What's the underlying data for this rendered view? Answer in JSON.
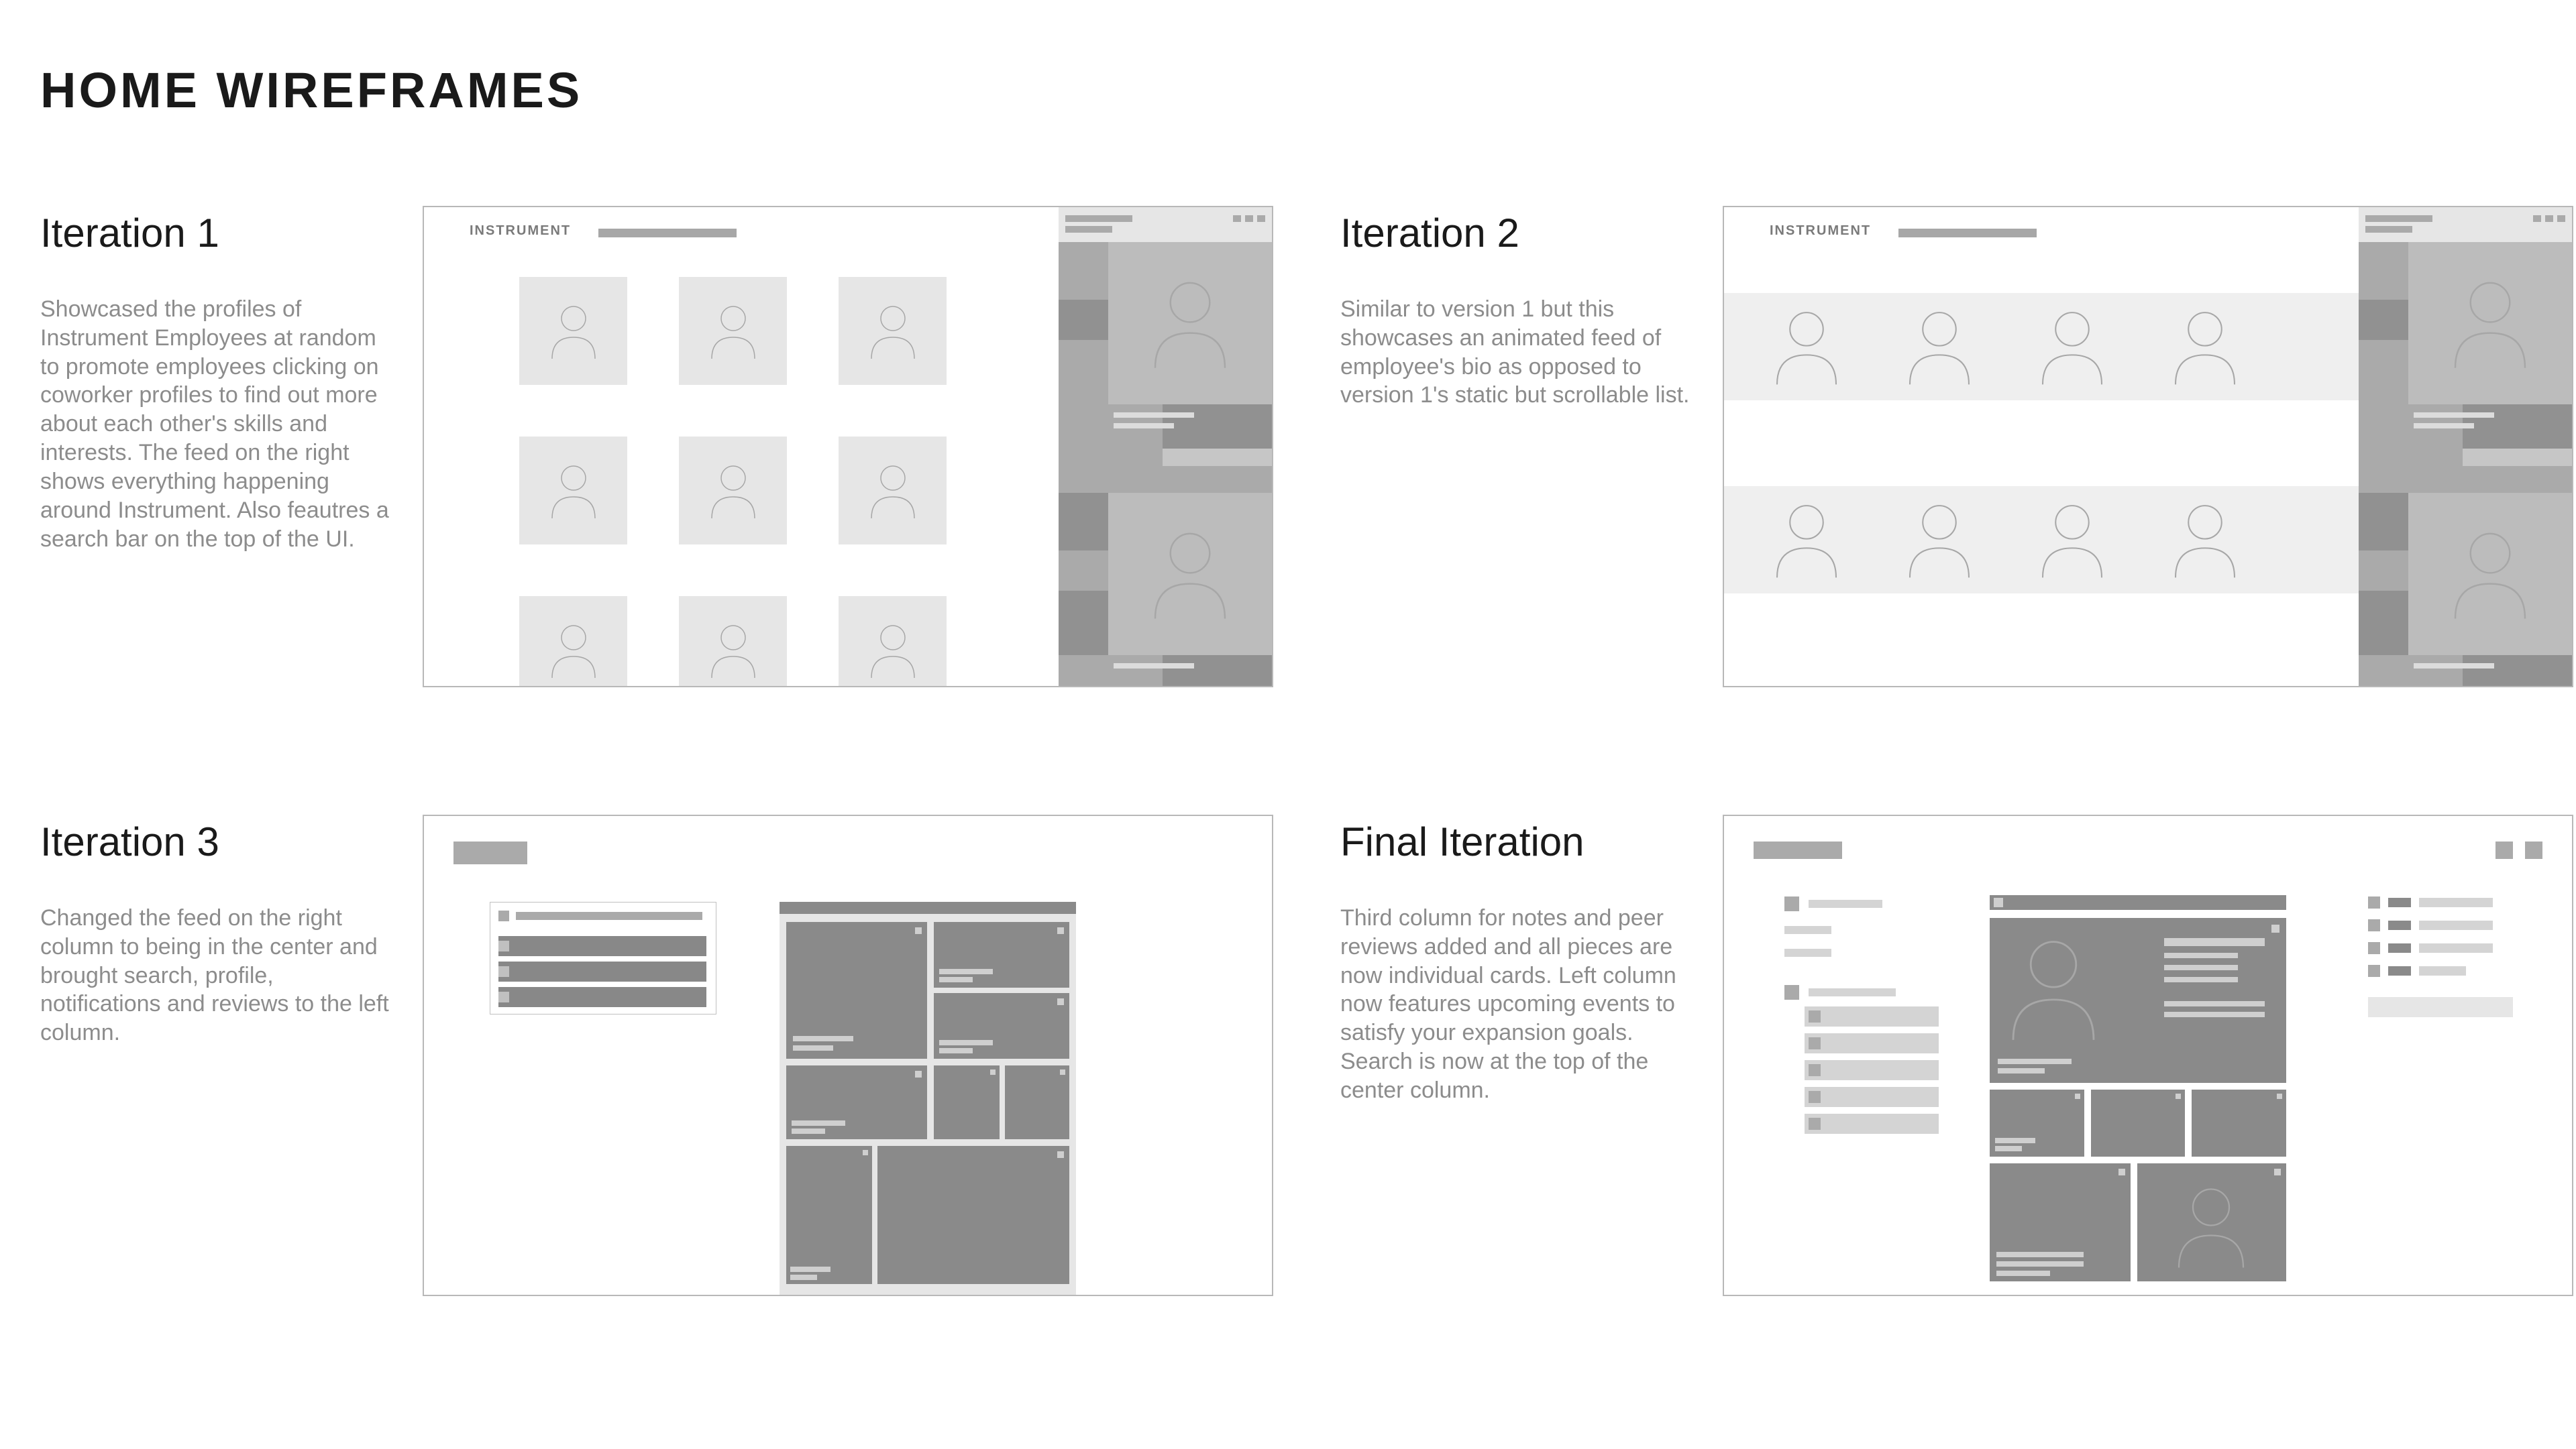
{
  "page_title": "HOME WIREFRAMES",
  "iterations": [
    {
      "title": "Iteration 1",
      "body": "Showcased the profiles of Instrument Employees at random to promote employees clicking on coworker profiles to find out more about each other's skills and interests. The feed on the right shows everything happening around Instrument. Also feautres a search bar on the top of the UI.",
      "logo": "INSTRUMENT"
    },
    {
      "title": "Iteration 2",
      "body": "Similar to version 1 but this showcases an animated feed of employee's bio as opposed to version 1's static but scrollable list.",
      "logo": "INSTRUMENT"
    },
    {
      "title": "Iteration 3",
      "body": "Changed the feed on the right column to being in the center and brought search, profile, notifications and reviews to the left column."
    },
    {
      "title": "Final Iteration",
      "body": "Third column for notes and peer reviews added and all pieces are now individual cards. Left column now features upcoming events to satisfy your expansion goals. Search is now at the top of the center column."
    }
  ]
}
